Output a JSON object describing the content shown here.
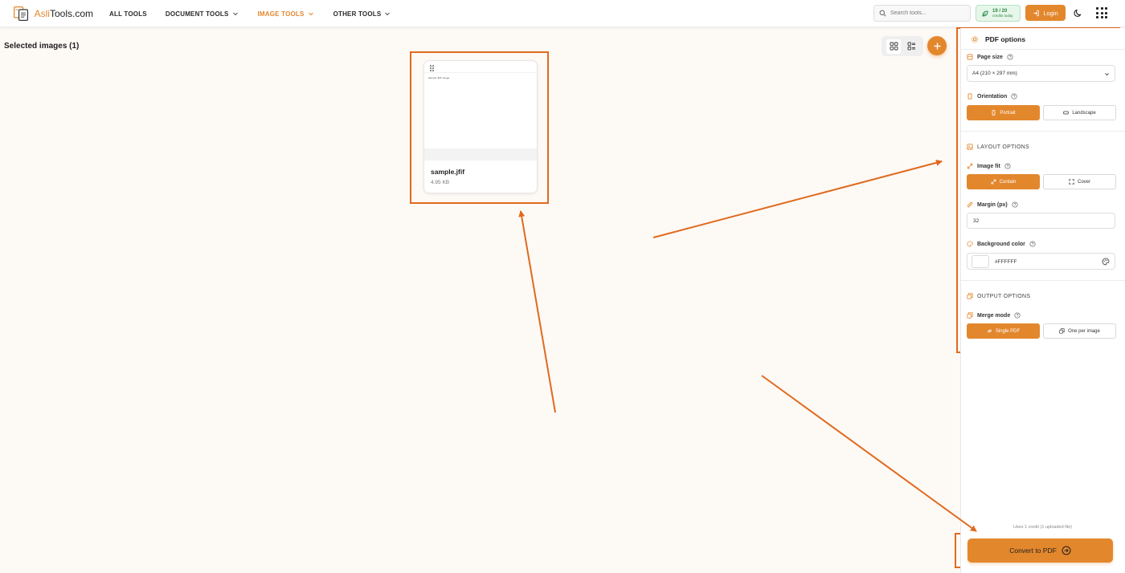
{
  "header": {
    "logo_prefix": "Asli",
    "logo_suffix": "Tools.com",
    "nav": [
      {
        "label": "ALL TOOLS",
        "dropdown": false,
        "active": false
      },
      {
        "label": "DOCUMENT TOOLS",
        "dropdown": true,
        "active": false
      },
      {
        "label": "IMAGE TOOLS",
        "dropdown": true,
        "active": true
      },
      {
        "label": "OTHER TOOLS",
        "dropdown": true,
        "active": false
      }
    ],
    "search_placeholder": "Search tools...",
    "credits_count": "19 / 20",
    "credits_sub": "credits today",
    "login_label": "Login"
  },
  "main": {
    "selected_title": "Selected images (1)",
    "card": {
      "preview_text": "Sample JFIF Image",
      "name": "sample.jfif",
      "size": "4.95 KB"
    }
  },
  "sidebar": {
    "title": "PDF options",
    "page_size_label": "Page size",
    "page_size_value": "A4 (210 × 297 mm)",
    "orientation_label": "Orientation",
    "orientation_portrait": "Portrait",
    "orientation_landscape": "Landscape",
    "layout_section": "LAYOUT OPTIONS",
    "image_fit_label": "Image fit",
    "fit_contain": "Contain",
    "fit_cover": "Cover",
    "margin_label": "Margin (px)",
    "margin_value": "32",
    "bg_color_label": "Background color",
    "bg_color_value": "#FFFFFF",
    "output_section": "OUTPUT OPTIONS",
    "merge_mode_label": "Merge mode",
    "merge_single": "Single PDF",
    "merge_per_image": "One per image",
    "footnote": "Uses 1 credit (1 uploaded file)",
    "convert_label": "Convert to PDF"
  },
  "colors": {
    "accent": "#e3872d",
    "annotation": "#e06a1e",
    "background": "#fdf9f5"
  },
  "icons": [
    "document-logo-icon",
    "chevron-down-icon",
    "search-icon",
    "leaf-icon",
    "login-icon",
    "moon-icon",
    "apps-grid-icon",
    "grid-view-icon",
    "list-view-icon",
    "plus-icon",
    "drag-handle-icon",
    "gear-icon",
    "page-size-icon",
    "help-icon",
    "phone-icon",
    "landscape-icon",
    "layout-icon",
    "resize-icon",
    "expand-icon",
    "ruler-icon",
    "palette-icon",
    "output-icon",
    "link-icon",
    "copy-icon",
    "arrow-circle-right-icon"
  ]
}
